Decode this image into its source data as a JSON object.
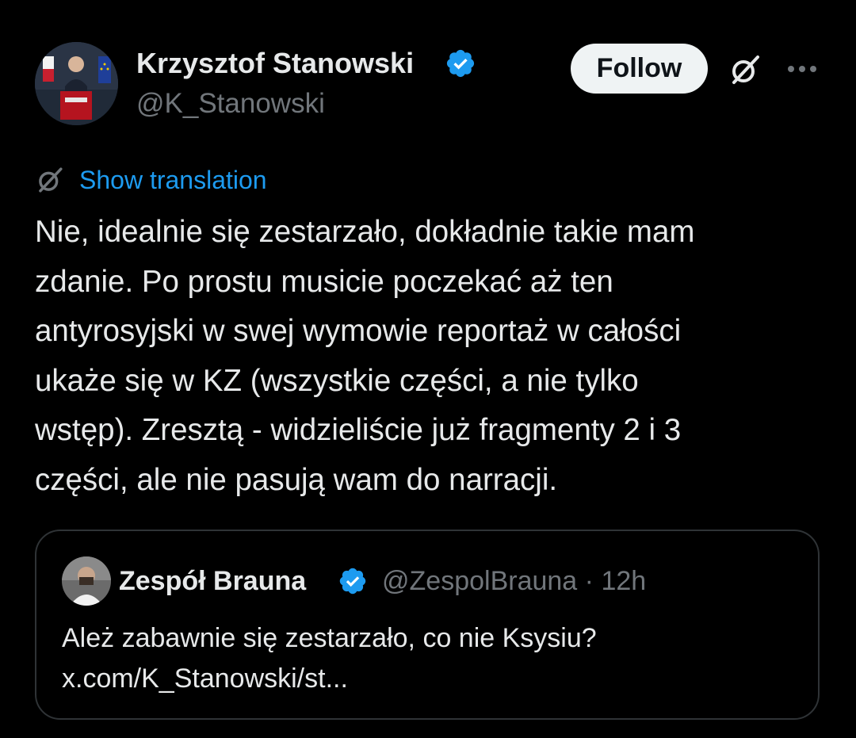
{
  "colors": {
    "background": "#000000",
    "text_primary": "#e7e9ea",
    "text_secondary": "#71767b",
    "accent": "#1d9bf0",
    "follow_button_bg": "#eff3f4",
    "border": "#2f3336"
  },
  "author": {
    "display_name": "Krzysztof Stanowski",
    "handle": "@K_Stanowski",
    "verified_icon": "verified-badge-icon"
  },
  "header": {
    "follow_label": "Follow",
    "grok_icon": "grok-icon",
    "more_icon": "more-horizontal-icon"
  },
  "translation": {
    "label": "Show translation",
    "icon": "grok-icon"
  },
  "tweet": {
    "text": "Nie, idealnie się zestarzało, dokładnie takie mam\nzdanie. Po prostu musicie poczekać aż ten\nantyrosyjski w swej wymowie reportaż w całości\nukaże się w KZ (wszystkie części, a nie tylko\nwstęp). Zresztą - widzieliście już fragmenty 2 i 3\nczęści, ale nie pasują wam do narracji."
  },
  "quoted_tweet": {
    "display_name": "Zespół Brauna",
    "handle": "@ZespolBrauna",
    "separator": "·",
    "time": "12h",
    "text": "Ależ zabawnie się zestarzało, co nie Ksysiu?\nx.com/K_Stanowski/st..."
  }
}
